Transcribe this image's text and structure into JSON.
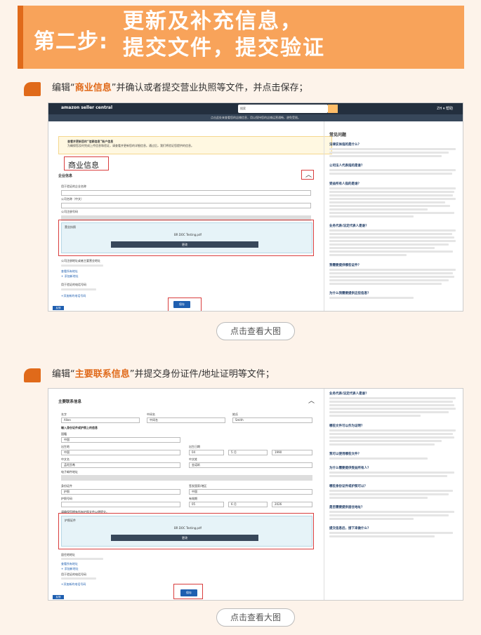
{
  "banner": {
    "step": "第二步:",
    "title_line1": "更新及补充信息，",
    "title_line2": "提交文件，提交验证"
  },
  "section1": {
    "prefix": "编辑“",
    "highlight": "商业信息",
    "suffix": "”并确认或者提交营业执照等文件，并点击保存；"
  },
  "section2": {
    "prefix": "编辑“",
    "highlight": "主要联系信息",
    "suffix": "”并提交身份证件/地址证明等文件；"
  },
  "view_large_label": "点击查看大图",
  "shot1": {
    "logo": "amazon seller central",
    "search_value": "搜索",
    "nav_right": "ZH ▾   帮助",
    "subbar": "点击此处来查看您的店铺信息，用以保持您的店铺运营通畅，避免受限。",
    "warning_title": "查看并更新您的“信赖信息”账户信息",
    "warning_body": "为确保您及时完成上传信息和验证，请查看并更新您的详细信息。通过后，我们将验证您提供的信息。",
    "section_title": "商业信息",
    "subsection_title": "企业信息",
    "field1_label": "用于验证的企业名称",
    "field2_label": "公司名称（中文）",
    "field3_label": "公司注册号码",
    "upload_label": "营业执照",
    "file_name": "BR DOC Testing.pdf",
    "replace_button": "更改",
    "addr_label": "公司注册地址或者主要营业地址",
    "addr_link1": "查看所有地址",
    "addr_link2": "+ 添加新地址",
    "phone_label": "用于验证的电话号码",
    "phone_link": "+添加新的电话号码",
    "save_button": "保存",
    "footer_label": "反馈",
    "sidebar_title": "常见问题",
    "sidebar_q1": "法律实体指的是什么？",
    "sidebar_q2": "公司法人代表指的是谁？",
    "sidebar_q3": "受益所有人指的是谁？",
    "sidebar_q4": "业务代表/法定代表人是谁？",
    "sidebar_q5": "我需要提供哪些证件？",
    "sidebar_q6": "为什么我需要提供这些信息？"
  },
  "shot2": {
    "section_title": "主要联系信息",
    "first_name_label": "名字",
    "first_name_value": "Allen",
    "middle_name_label": "中间名",
    "middle_name_value": "中间名",
    "last_name_label": "姓氏",
    "last_name_value": "Smith",
    "id_header": "输入身份证件或护照上的信息",
    "id_country_label": "国籍",
    "id_country_value": "中国",
    "birth_country_label": "出生地",
    "birth_country_value": "中国",
    "dob_label": "出生日期",
    "dob_day": "04",
    "dob_month": "5 月",
    "dob_year": "1990",
    "name_cn_label": "中文名",
    "name_cn_value": "孟旺民希",
    "name_pinyin_label": "中文姓",
    "name_pinyin_value": "金诺昕",
    "email_label": "电子邮件地址",
    "doc_type_label": "身份证件",
    "doc_type_value": "护照",
    "issuer_label": "签发国家/地区",
    "issuer_value": "中国",
    "passport_label": "护照号码",
    "expiry_label": "有效期",
    "expiry_day": "05",
    "expiry_month": "6 月",
    "expiry_year": "2026",
    "upload_header": "请确保您拥有所有护照文件以便提交。",
    "upload_label": "护照证件",
    "file_name": "BR DOC Testing.pdf",
    "replace_button": "更改",
    "addr_label": "居住地地址",
    "addr_link1": "查看所有地址",
    "addr_link2": "+ 添加新地址",
    "phone_label": "用于验证的电话号码",
    "phone_link": "+添加新的电话号码",
    "save_button": "保存",
    "footer_label": "反馈",
    "sidebar_q1": "业务代表/法定代表人是谁？",
    "sidebar_q2": "哪些文件可以作为证明？",
    "sidebar_q3": "我可以使用哪些文件？",
    "sidebar_q4": "为什么需要提供受益所有人？",
    "sidebar_q5": "哪些身份证件或护照可以？",
    "sidebar_q6": "是否需要提供居住地址？",
    "sidebar_q7": "提交信息后，接下来做什么？"
  }
}
